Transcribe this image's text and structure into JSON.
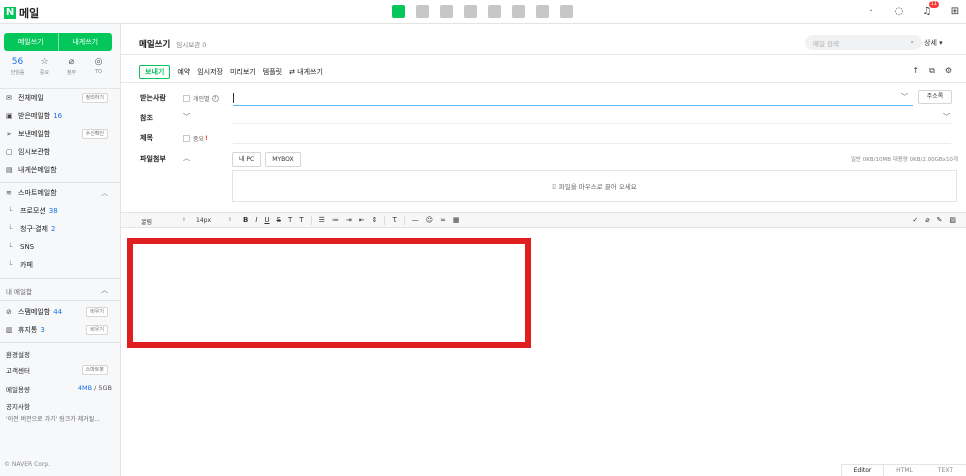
{
  "topbar": {
    "logo_letter": "N",
    "logo_text": "메일",
    "notif_count": "11",
    "dot_label": "·"
  },
  "sidebar": {
    "compose_label": "메일쓰기",
    "self_compose_label": "내게쓰기",
    "quick": [
      {
        "num": "56",
        "label": "안읽음"
      },
      {
        "icon": "☆",
        "label": "중요"
      },
      {
        "icon": "⌀",
        "label": "첨부"
      },
      {
        "icon": "◎",
        "label": "TO"
      }
    ],
    "items": {
      "all": {
        "label": "전체메일",
        "tag": "정리하기"
      },
      "inbox": {
        "label": "받은메일함",
        "count": "16"
      },
      "sent": {
        "label": "보낸메일함",
        "tag": "수신확인"
      },
      "drafts": {
        "label": "임시보관함"
      },
      "self": {
        "label": "내게쓴메일함"
      },
      "smart": {
        "label": "스마트메일함"
      },
      "promo": {
        "label": "프로모션",
        "count": "38"
      },
      "billing": {
        "label": "청구·결제",
        "count": "2"
      },
      "sns": {
        "label": "SNS"
      },
      "cafe": {
        "label": "카페"
      },
      "spam": {
        "label": "스팸메일함",
        "count": "44",
        "tag": "비우기"
      },
      "trash": {
        "label": "휴지통",
        "count": "3",
        "tag": "비우기"
      }
    },
    "my_mailbox_label": "내 메일함",
    "settings_label": "환경설정",
    "support_label": "고객센터",
    "support_tag": "스마트봇",
    "quota_label": "메일용량",
    "quota_used": "4MB",
    "quota_total": "/ 5GB",
    "notice_label": "공지사항",
    "notice_text": "'이전 버전으로 가기' 링크가 제거될...",
    "copyright": "© NAVER Corp."
  },
  "main": {
    "title": "메일쓰기",
    "saved_count": "임시보관 0",
    "search_placeholder": "메일 검색",
    "detail_label": "상세 ▾",
    "toolbar": [
      "보내기",
      "예약",
      "임시저장",
      "미리보기",
      "템플릿",
      "⇄ 내게쓰기"
    ],
    "to_label": "받는사람",
    "personal_label": "개인별",
    "help_mark": "?",
    "address_book_label": "주소록",
    "cc_label": "참조",
    "subject_label": "제목",
    "important_label": "중요",
    "important_mark": "!",
    "attach_label": "파일첨부",
    "my_pc_label": "내 PC",
    "mybox_label": "MYBOX",
    "attach_info": "일반 0KB/10MB  대용량 0KB/2.00GBx10개",
    "dropzone_text": "파일을 마우스로 끌어 오세요",
    "editor": {
      "font": "굴림",
      "size": "14px",
      "modes": [
        "Editor",
        "HTML",
        "TEXT"
      ]
    }
  }
}
